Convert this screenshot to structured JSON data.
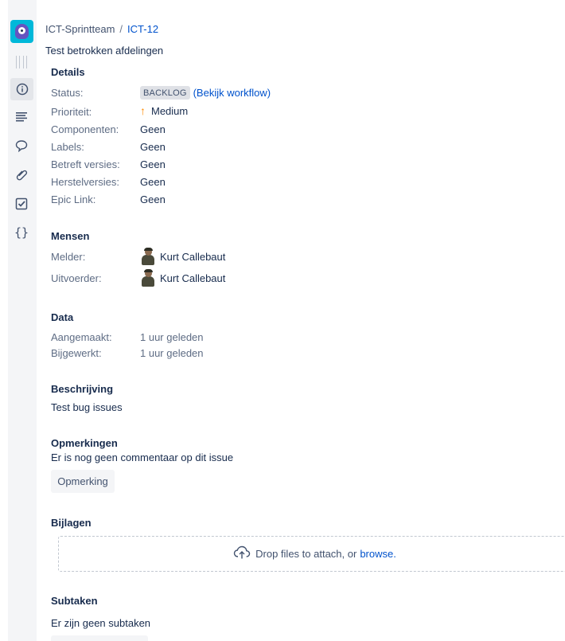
{
  "breadcrumb": {
    "project": "ICT-Sprintteam",
    "separator": "/",
    "issue_key": "ICT-12"
  },
  "summary": "Test betrokken afdelingen",
  "sidebar": {
    "icons": [
      "project-logo-icon",
      "drag-handle-icon",
      "info-icon",
      "description-icon",
      "comment-icon",
      "attachment-icon",
      "checkbox-icon",
      "code-braces-icon"
    ]
  },
  "details": {
    "title": "Details",
    "status_label": "Status:",
    "status_value": "BACKLOG",
    "workflow_link": "(Bekijk workflow)",
    "priority_label": "Prioriteit:",
    "priority_value": "Medium",
    "components_label": "Componenten:",
    "components_value": "Geen",
    "labels_label": "Labels:",
    "labels_value": "Geen",
    "affects_label": "Betreft versies:",
    "affects_value": "Geen",
    "fix_label": "Herstelversies:",
    "fix_value": "Geen",
    "epic_label": "Epic Link:",
    "epic_value": "Geen"
  },
  "people": {
    "title": "Mensen",
    "reporter_label": "Melder:",
    "reporter_value": "Kurt Callebaut",
    "assignee_label": "Uitvoerder:",
    "assignee_value": "Kurt Callebaut"
  },
  "dates": {
    "title": "Data",
    "created_label": "Aangemaakt:",
    "created_value": "1 uur geleden",
    "updated_label": "Bijgewerkt:",
    "updated_value": "1 uur geleden"
  },
  "description": {
    "title": "Beschrijving",
    "text": "Test bug issues"
  },
  "comments": {
    "title": "Opmerkingen",
    "empty_text": "Er is nog geen commentaar op dit issue",
    "button_label": "Opmerking"
  },
  "attachments": {
    "title": "Bijlagen",
    "drop_text": "Drop files to attach, or",
    "browse_link": "browse."
  },
  "subtasks": {
    "title": "Subtaken",
    "empty_text": "Er zijn geen subtaken"
  },
  "colors": {
    "link": "#0052cc",
    "priority_medium": "#ff8b00",
    "logo_bg": "#00b8d9",
    "logo_face": "#6554c0",
    "lozenge_bg": "#dfe1e6"
  }
}
